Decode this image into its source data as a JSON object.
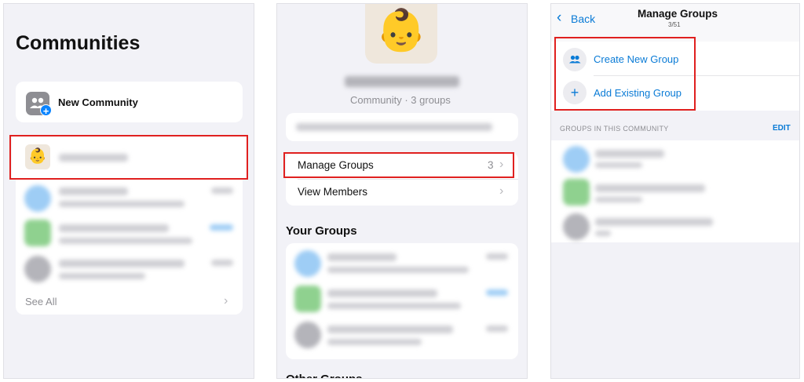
{
  "panel1": {
    "title": "Communities",
    "new_community_label": "New Community",
    "see_all_label": "See All",
    "community_emoji": "👶"
  },
  "panel2": {
    "avatar_emoji": "👶",
    "subtitle": "Community · 3 groups",
    "manage_groups_label": "Manage Groups",
    "manage_groups_count": "3",
    "view_members_label": "View Members",
    "your_groups_heading": "Your Groups",
    "other_groups_heading": "Other Groups"
  },
  "panel3": {
    "back_label": "Back",
    "title": "Manage Groups",
    "counter": "3/51",
    "create_new_group_label": "Create New Group",
    "add_existing_group_label": "Add Existing Group",
    "section_header": "GROUPS IN THIS COMMUNITY",
    "edit_label": "EDIT"
  },
  "colors": {
    "accent_blue": "#0a7bd6",
    "highlight_red": "#e0201f",
    "background_gray": "#f2f2f7"
  },
  "icons": {
    "new_community": "community-group-plus-icon",
    "create_group": "people-icon",
    "add_group": "plus-icon",
    "back": "chevron-left-icon",
    "disclosure": "chevron-right-icon"
  }
}
